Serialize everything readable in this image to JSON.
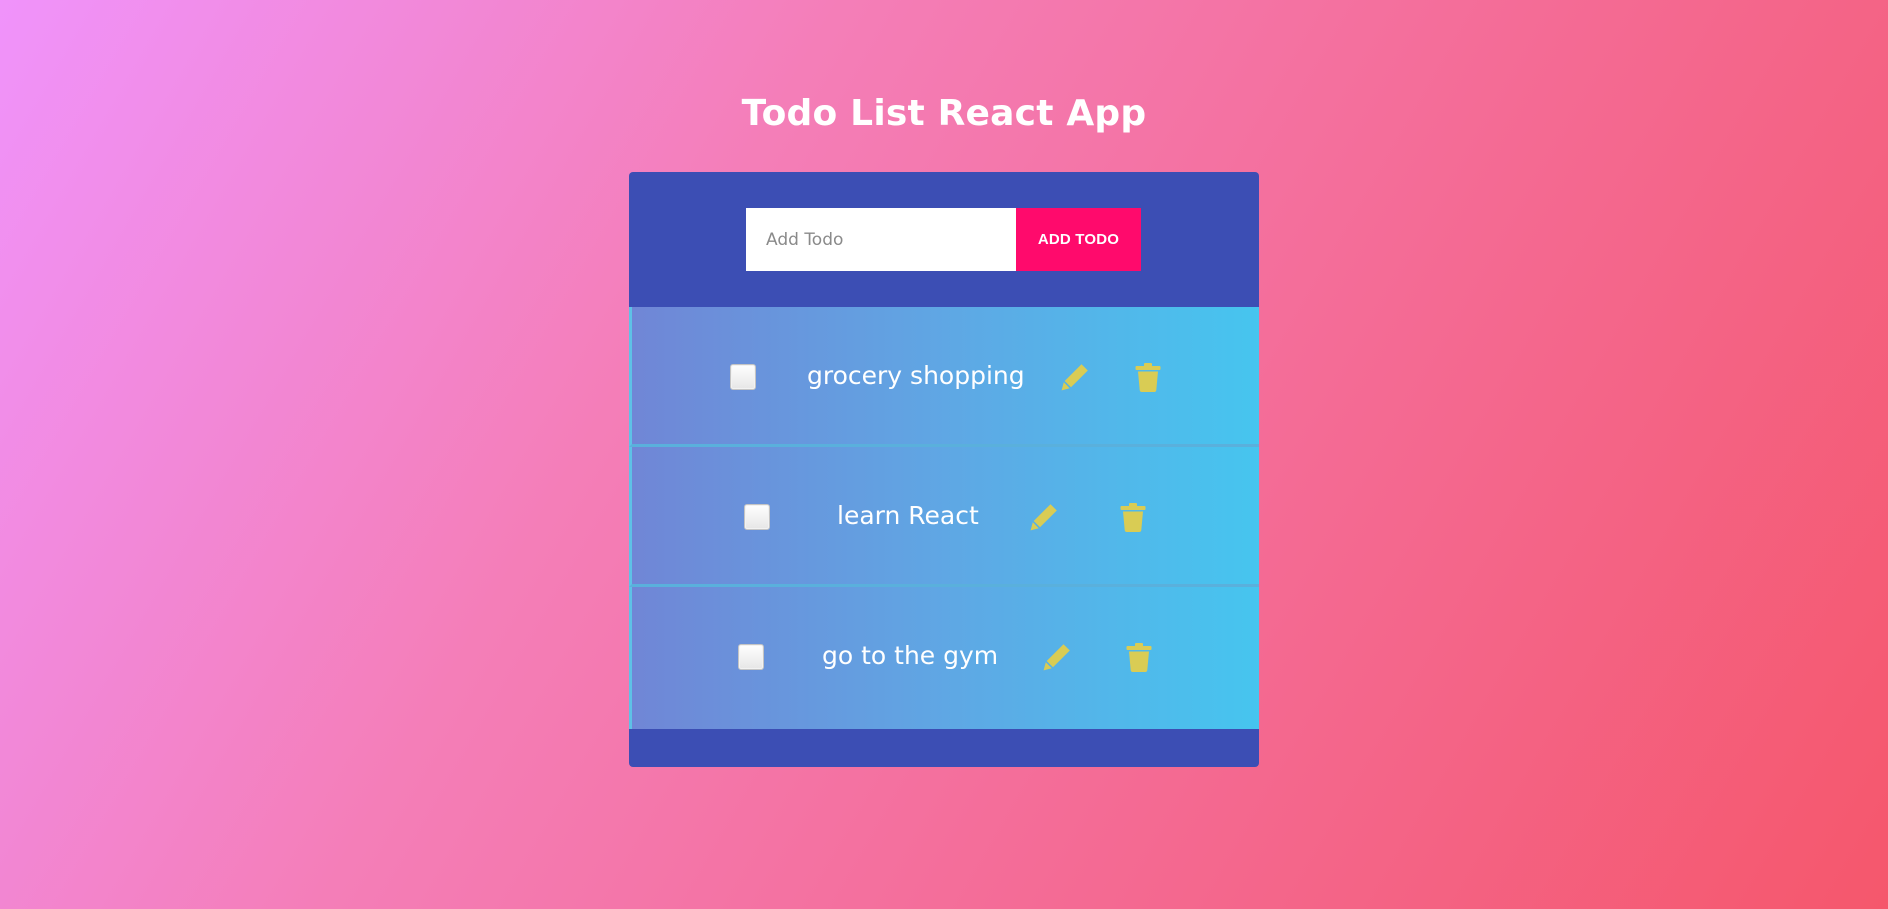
{
  "app": {
    "title": "Todo List React App"
  },
  "form": {
    "input_placeholder": "Add Todo",
    "input_value": "",
    "add_button_label": "ADD TODO"
  },
  "todos": [
    {
      "text": "grocery shopping",
      "completed": false
    },
    {
      "text": "learn React",
      "completed": false
    },
    {
      "text": "go to the gym",
      "completed": false
    }
  ],
  "icons": {
    "edit": "pencil-icon",
    "delete": "trash-icon"
  },
  "colors": {
    "card_background": "#3c4eb4",
    "add_button": "#ff0a6c",
    "icon_yellow": "#d9cc54",
    "title_text": "#ffffff"
  }
}
